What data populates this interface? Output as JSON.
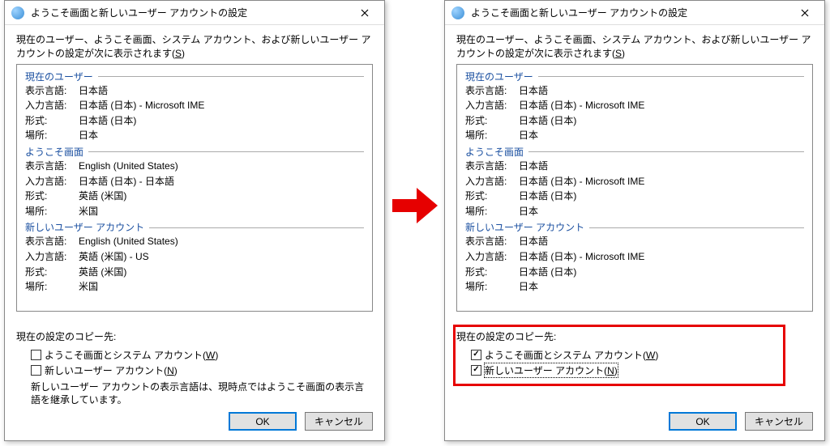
{
  "title": "ようこそ画面と新しいユーザー アカウントの設定",
  "intro_prefix": "現在のユーザー、ようこそ画面、システム アカウント、および新しいユーザー アカウントの設定が次に表示されます(",
  "intro_key": "S",
  "intro_suffix": ")",
  "labels": {
    "display": "表示言語:",
    "input": "入力言語:",
    "format": "形式:",
    "location": "場所:"
  },
  "groups": {
    "current": "現在のユーザー",
    "welcome": "ようこそ画面",
    "newuser": "新しいユーザー アカウント"
  },
  "left": {
    "current": {
      "display": "日本語",
      "input": "日本語 (日本) - Microsoft IME",
      "format": "日本語 (日本)",
      "location": "日本"
    },
    "welcome": {
      "display": "English (United States)",
      "input": "日本語 (日本) - 日本語",
      "format": "英語 (米国)",
      "location": "米国"
    },
    "newuser": {
      "display": "English (United States)",
      "input": "英語 (米国) - US",
      "format": "英語 (米国)",
      "location": "米国"
    }
  },
  "right": {
    "current": {
      "display": "日本語",
      "input": "日本語 (日本) - Microsoft IME",
      "format": "日本語 (日本)",
      "location": "日本"
    },
    "welcome": {
      "display": "日本語",
      "input": "日本語 (日本) - Microsoft IME",
      "format": "日本語 (日本)",
      "location": "日本"
    },
    "newuser": {
      "display": "日本語",
      "input": "日本語 (日本) - Microsoft IME",
      "format": "日本語 (日本)",
      "location": "日本"
    }
  },
  "copy": {
    "heading": "現在の設定のコピー先:",
    "opt1_prefix": "ようこそ画面とシステム アカウント(",
    "opt1_key": "W",
    "opt1_suffix": ")",
    "opt2_prefix": "新しいユーザー アカウント(",
    "opt2_key": "N",
    "opt2_suffix": ")"
  },
  "note": "新しいユーザー アカウントの表示言語は、現時点ではようこそ画面の表示言語を継承しています。",
  "buttons": {
    "ok": "OK",
    "cancel": "キャンセル"
  }
}
